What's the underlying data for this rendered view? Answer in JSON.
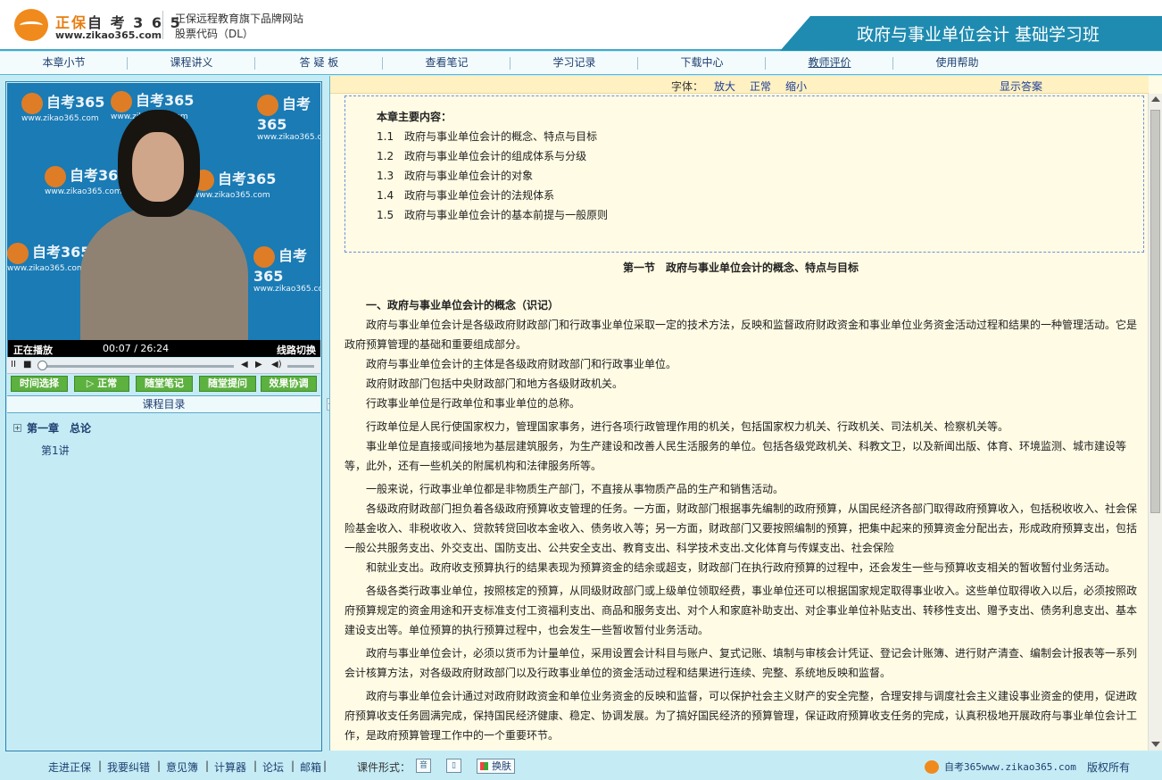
{
  "header": {
    "logo_text_accent": "正保",
    "logo_text_rest": "自 考 3 6 5",
    "logo_url": "www.zikao365.com",
    "tagline": "正保远程教育旗下品牌网站",
    "stock_code": "股票代码（DL）",
    "course_title": "政府与事业单位会计 基础学习班"
  },
  "nav": {
    "items": [
      "本章小节",
      "课程讲义",
      "答 疑 板",
      "查看笔记",
      "学习记录",
      "下载中心",
      "教师评价",
      "使用帮助"
    ]
  },
  "video": {
    "watermark_text": "自考365",
    "watermark_url": "www.zikao365.com",
    "status": "正在播放",
    "time": "00:07  /  26:24",
    "line_switch": "线路切换"
  },
  "controls": {
    "play_pause": "II",
    "stop": "■",
    "prev": "◀",
    "next": "▶",
    "volume": "◀)"
  },
  "actions": [
    "时间选择",
    "▷ 正常",
    "随堂笔记",
    "随堂提问",
    "效果协调"
  ],
  "toc": {
    "header": "课程目录",
    "expand_icon": "+",
    "chapter": "第一章　总论",
    "lecture": "第1讲"
  },
  "splitter_glyph": "<",
  "font_toolbar": {
    "label": "字体：",
    "larger": "放大",
    "normal": "正常",
    "smaller": "缩小",
    "show_answer": "显示答案"
  },
  "summary": {
    "title": "本章主要内容：",
    "items": [
      "1.1　政府与事业单位会计的概念、特点与目标",
      "1.2　政府与事业单位会计的组成体系与分级",
      "1.3　政府与事业单位会计的对象",
      "1.4　政府与事业单位会计的法规体系",
      "1.5　政府与事业单位会计的基本前提与一般原则"
    ]
  },
  "article": {
    "section_title": "第一节　政府与事业单位会计的概念、特点与目标",
    "heading_1": "一、政府与事业单位会计的概念（识记）",
    "paragraphs": [
      "政府与事业单位会计是各级政府财政部门和行政事业单位采取一定的技术方法，反映和监督政府财政资金和事业单位业务资金活动过程和结果的一种管理活动。它是政府预算管理的基础和重要组成部分。",
      "政府与事业单位会计的主体是各级政府财政部门和行政事业单位。",
      "政府财政部门包括中央财政部门和地方各级财政机关。",
      "行政事业单位是行政单位和事业单位的总称。",
      "行政单位是人民行使国家权力，管理国家事务，进行各项行政管理作用的机关，包括国家权力机关、行政机关、司法机关、检察机关等。",
      "事业单位是直接或间接地为基层建筑服务，为生产建设和改善人民生活服务的单位。包括各级党政机关、科教文卫，以及新闻出版、体育、环境监测、城市建设等等，此外，还有一些机关的附属机构和法律服务所等。",
      "一般来说，行政事业单位都是非物质生产部门，不直接从事物质产品的生产和销售活动。",
      "各级政府财政部门担负着各级政府预算收支管理的任务。一方面，财政部门根据事先编制的政府预算，从国民经济各部门取得政府预算收入，包括税收收入、社会保险基金收入、非税收收入、贷款转贷回收本金收入、债务收入等；另一方面，财政部门又要按照编制的预算，把集中起来的预算资金分配出去，形成政府预算支出，包括一般公共服务支出、外交支出、国防支出、公共安全支出、教育支出、科学技术支出.文化体育与传媒支出、社会保险",
      "和就业支出。政府收支预算执行的结果表现为预算资金的结余或超支，财政部门在执行政府预算的过程中，还会发生一些与预算收支相关的暂收暂付业务活动。",
      "各级各类行政事业单位，按照核定的预算，从同级财政部门或上级单位领取经费，事业单位还可以根据国家规定取得事业收入。这些单位取得收入以后，必须按照政府预算规定的资金用途和开支标准支付工资福利支出、商品和服务支出、对个人和家庭补助支出、对企事业单位补贴支出、转移性支出、赠予支出、债务利息支出、基本建设支出等。单位预算的执行预算过程中，也会发生一些暂收暂付业务活动。",
      "政府与事业单位会计，必须以货币为计量单位，采用设置会计科目与账户、复式记账、填制与审核会计凭证、登记会计账簿、进行财产清查、编制会计报表等一系列会计核算方法，对各级政府财政部门以及行政事业单位的资金活动过程和结果进行连续、完整、系统地反映和监督。",
      "政府与事业单位会计通过对政府财政资金和单位业务资金的反映和监督，可以保护社会主义财产的安全完整，合理安排与调度社会主义建设事业资金的使用，促进政府预算收支任务圆满完成，保持国民经济健康、稳定、协调发展。为了搞好国民经济的预算管理，保证政府预算收支任务的完成，认真积极地开展政府与事业单位会计工作，是政府预算管理工作中的一个重要环节。"
    ]
  },
  "footer": {
    "links": [
      "走进正保",
      "我要纠错",
      "意见簿",
      "计算器",
      "论坛",
      "邮箱"
    ],
    "separator": "|",
    "course_form_label": "课件形式：",
    "audio_icon": "音",
    "layout_icon": "▯",
    "skin_label": "换肤",
    "site_text": "自考365www.zikao365.com",
    "copyright": "版权所有"
  },
  "colors": {
    "page_bg": "#c5ecf5",
    "banner": "#1f8bb0",
    "content_bg": "#fffbe4",
    "button_green": "#5cb13f",
    "logo_orange": "#f08a1c",
    "link_blue": "#1d3f70"
  }
}
